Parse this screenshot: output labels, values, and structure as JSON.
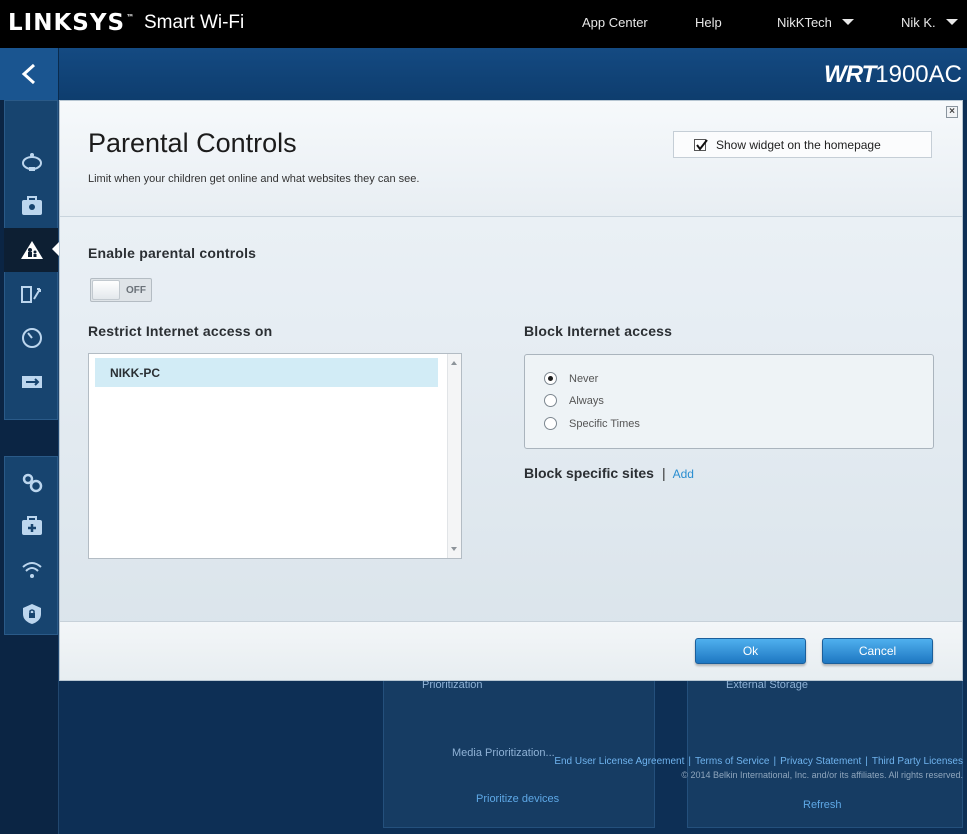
{
  "brand": {
    "logo": "LINKSYS",
    "tm": "™",
    "product": "Smart Wi-Fi",
    "model_prefix": "WRT",
    "model_suffix": "1900AC"
  },
  "topnav": {
    "app_center": "App Center",
    "help": "Help",
    "network": "NikKTech",
    "user": "Nik K."
  },
  "modal": {
    "close": "×",
    "title": "Parental Controls",
    "subtitle": "Limit when your children get online and what websites they can see.",
    "widget_label": "Show widget on the homepage",
    "widget_checked": true,
    "enable_label": "Enable parental controls",
    "toggle_state": "OFF",
    "restrict_label": "Restrict Internet access on",
    "devices": [
      "NIKK-PC"
    ],
    "block_label": "Block Internet access",
    "block_options": [
      {
        "label": "Never",
        "selected": true
      },
      {
        "label": "Always",
        "selected": false
      },
      {
        "label": "Specific Times",
        "selected": false
      }
    ],
    "block_sites_label": "Block specific sites",
    "separator": "|",
    "add_link": "Add",
    "ok": "Ok",
    "cancel": "Cancel"
  },
  "background": {
    "card_left_title": "Prioritization",
    "card_left_text": "Media Prioritization...",
    "card_left_link": "Prioritize devices",
    "card_right_title": "External Storage",
    "card_right_link": "Refresh"
  },
  "footer": {
    "links": [
      "End User License Agreement",
      "Terms of Service",
      "Privacy Statement",
      "Third Party Licenses"
    ],
    "copyright": "© 2014 Belkin International, Inc. and/or its affiliates. All rights reserved."
  },
  "colors": {
    "accent": "#2a8ed0",
    "button": "#2f8fd8",
    "nav_dark": "#0b2544"
  }
}
